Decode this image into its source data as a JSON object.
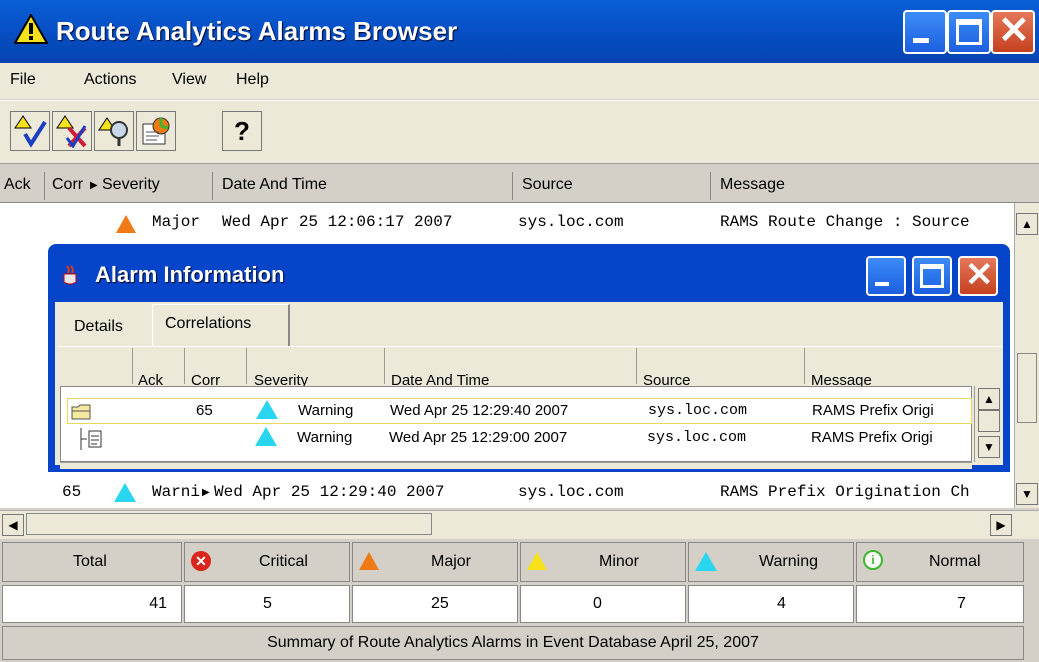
{
  "window": {
    "title": "Route Analytics Alarms Browser",
    "title_icon": "warning-triangle-icon"
  },
  "menu": [
    "File",
    "Actions",
    "View",
    "Help"
  ],
  "toolbar": {
    "help_glyph": "?",
    "icons": [
      "acknowledge-alarm-icon",
      "clear-alarm-icon",
      "inspect-alarm-icon",
      "alarm-report-icon",
      "help-icon"
    ]
  },
  "columns": [
    "Ack",
    "Corr",
    "Severity",
    "Date And Time",
    "Source",
    "Message"
  ],
  "rows": [
    {
      "ack": "",
      "corr": "",
      "severity": "Major",
      "datetime": "Wed Apr 25 12:06:17 2007",
      "source": "sys.loc.com",
      "message": "RAMS Route Change : Source"
    },
    {
      "ack": "",
      "corr": "65",
      "severity": "Warni",
      "datetime": "Wed Apr 25 12:29:40 2007",
      "source": "sys.loc.com",
      "message": "RAMS Prefix Origination Ch"
    }
  ],
  "dialog": {
    "title": "Alarm Information",
    "tabs": [
      "Details",
      "Correlations"
    ],
    "active_tab": "Correlations",
    "columns": [
      "Ack",
      "Corr",
      "Severity",
      "Date And Time",
      "Source",
      "Message"
    ],
    "rows": [
      {
        "ack": "",
        "corr": "65",
        "severity": "Warning",
        "datetime": "Wed Apr 25 12:29:40 2007",
        "source": "sys.loc.com",
        "message": "RAMS Prefix Origi"
      },
      {
        "ack": "",
        "corr": "",
        "severity": "Warning",
        "datetime": "Wed Apr 25 12:29:00 2007",
        "source": "sys.loc.com",
        "message": "RAMS Prefix Origi"
      }
    ]
  },
  "summary": {
    "labels": [
      "Total",
      "Critical",
      "Major",
      "Minor",
      "Warning",
      "Normal"
    ],
    "values": [
      "41",
      "5",
      "25",
      "0",
      "4",
      "7"
    ],
    "footer": "Summary of Route Analytics Alarms in Event Database April 25, 2007"
  },
  "colors": {
    "titlebar": "#0752c8",
    "major": "#f07a16",
    "minor": "#f5e21a",
    "warning": "#29d6f0",
    "critical": "#d9261c",
    "normal": "#3cb82c"
  }
}
